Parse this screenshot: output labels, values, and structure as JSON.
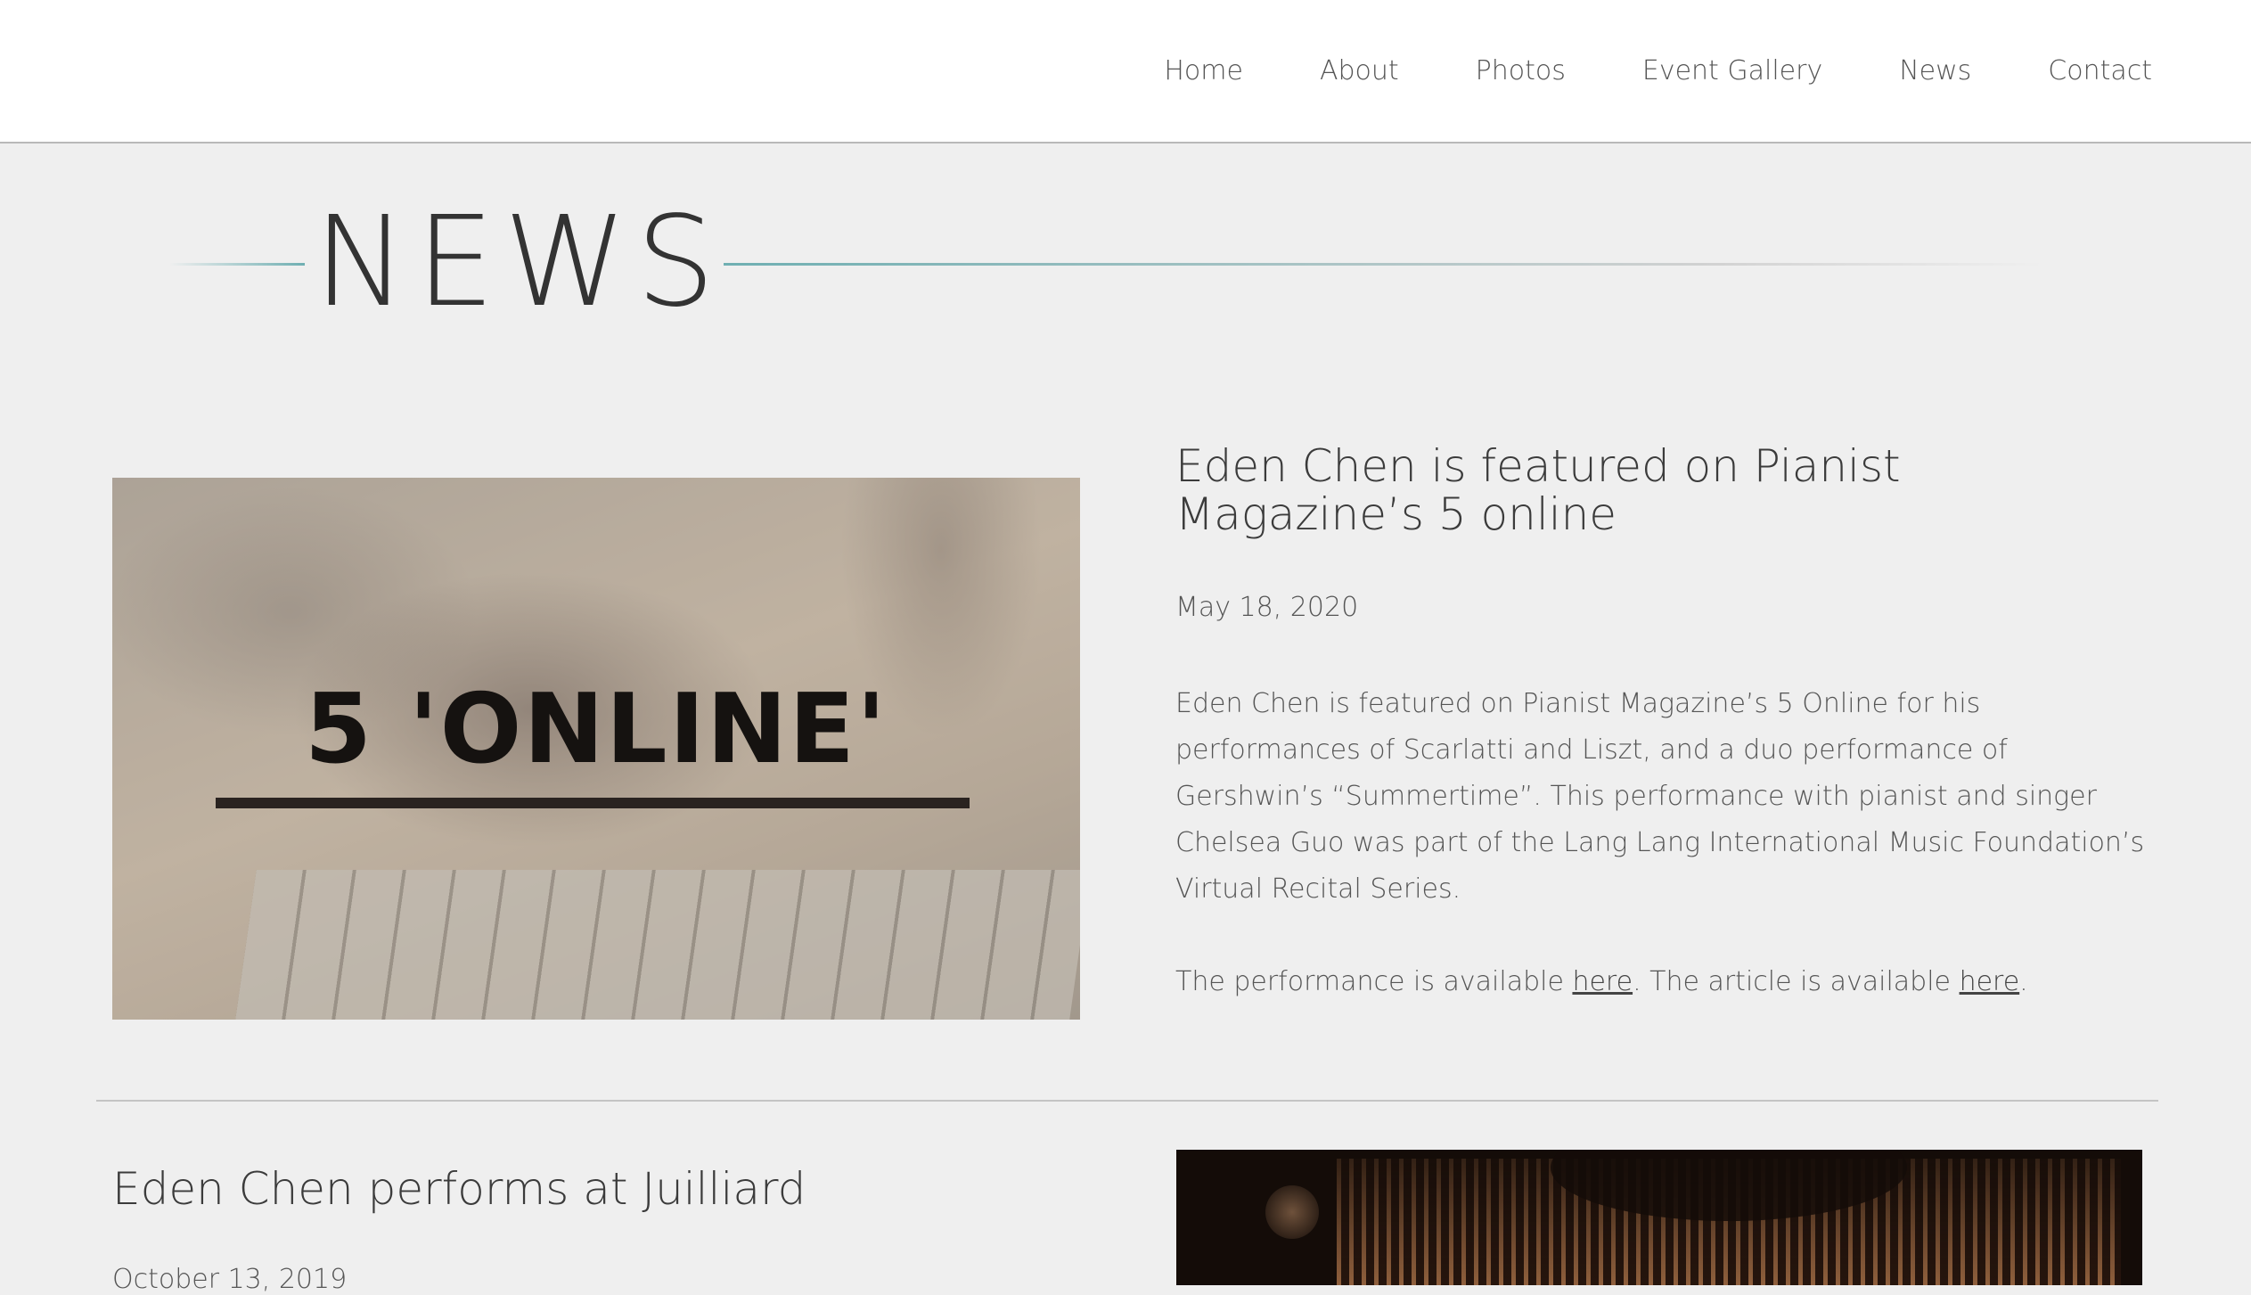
{
  "nav": {
    "items": [
      "Home",
      "About",
      "Photos",
      "Event Gallery",
      "News",
      "Contact"
    ]
  },
  "page": {
    "heading": "NEWS"
  },
  "posts": [
    {
      "image_text": "5 'ONLINE'",
      "title": "Eden Chen is featured on Pianist Magazine’s 5 online",
      "date": "May 18, 2020",
      "body": "Eden Chen is featured on Pianist Magazine’s 5 Online for his performances of Scarlatti and Liszt, and a duo performance of Gershwin’s “Summertime”. This performance with pianist and singer Chelsea Guo was part of the Lang Lang International Music Foundation’s Virtual Recital Series.",
      "links": {
        "performance_prefix": "The performance is available ",
        "performance_link": "here",
        "article_prefix": ". The article is available ",
        "article_link": "here",
        "suffix": "."
      }
    },
    {
      "title": "Eden Chen performs at Juilliard",
      "date": "October 13, 2019"
    }
  ],
  "colors": {
    "accent_line": "#6fafb2",
    "background": "#efefef",
    "header_bg": "#ffffff"
  }
}
